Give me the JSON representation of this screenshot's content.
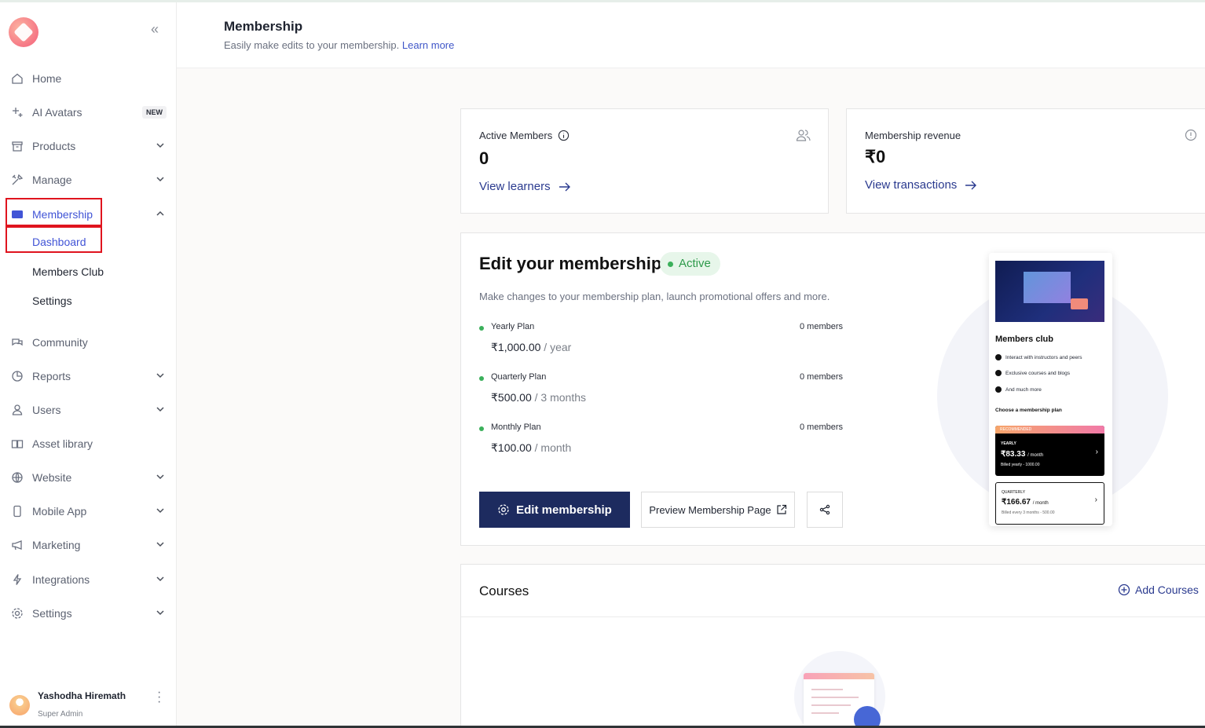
{
  "sidebar": {
    "items": [
      {
        "label": "Home",
        "icon": "home-icon"
      },
      {
        "label": "AI Avatars",
        "icon": "sparkle-icon",
        "badge": "NEW"
      },
      {
        "label": "Products",
        "icon": "box-icon"
      },
      {
        "label": "Manage",
        "icon": "tools-icon"
      },
      {
        "label": "Membership",
        "icon": "ticket-icon"
      },
      {
        "label": "Community",
        "icon": "chat-icon"
      },
      {
        "label": "Reports",
        "icon": "pie-chart-icon"
      },
      {
        "label": "Users",
        "icon": "user-icon"
      },
      {
        "label": "Asset library",
        "icon": "book-icon"
      },
      {
        "label": "Website",
        "icon": "globe-icon"
      },
      {
        "label": "Mobile App",
        "icon": "phone-icon"
      },
      {
        "label": "Marketing",
        "icon": "megaphone-icon"
      },
      {
        "label": "Integrations",
        "icon": "lightning-icon"
      },
      {
        "label": "Settings",
        "icon": "gear-icon"
      }
    ],
    "membership_sub": [
      "Dashboard",
      "Members Club",
      "Settings"
    ],
    "user": {
      "name": "Yashodha Hiremath",
      "role": "Super Admin"
    }
  },
  "header": {
    "title": "Membership",
    "subtitle": "Easily make edits to your membership.",
    "learn_more": "Learn more"
  },
  "stats": {
    "active_members": {
      "label": "Active Members",
      "value": "0",
      "link": "View learners"
    },
    "revenue": {
      "label": "Membership revenue",
      "value": "₹0",
      "link": "View transactions"
    }
  },
  "edit": {
    "title": "Edit your membership",
    "status": "Active",
    "description": "Make changes to your membership plan, launch promotional offers and more.",
    "plans": [
      {
        "name": "Yearly Plan",
        "members": "0 members",
        "price": "₹1,000.00",
        "period": "/ year"
      },
      {
        "name": "Quarterly Plan",
        "members": "0 members",
        "price": "₹500.00",
        "period": "/ 3 months"
      },
      {
        "name": "Monthly Plan",
        "members": "0 members",
        "price": "₹100.00",
        "period": "/ month"
      }
    ],
    "edit_button": "Edit membership",
    "preview_button": "Preview Membership Page"
  },
  "preview": {
    "title": "Members club",
    "bullets": [
      "Interact with instructors and peers",
      "Exclusive courses and blogs",
      "And much more"
    ],
    "choose": "Choose a membership plan",
    "yearly": {
      "tag": "RECOMMENDED",
      "name": "YEARLY",
      "price": "₹83.33",
      "per": "/ month",
      "billed": "Billed yearly - 1000.00"
    },
    "quarterly": {
      "name": "QUARTERLY",
      "price": "₹166.67",
      "per": "/ month",
      "billed": "Billed every 3 months - 500.00"
    }
  },
  "courses": {
    "title": "Courses",
    "add": "Add Courses"
  },
  "colors": {
    "accent": "#4154d6",
    "primary_button": "#1d2b5f",
    "active_green": "#3bb05b",
    "highlight_box": "#e0141e"
  }
}
